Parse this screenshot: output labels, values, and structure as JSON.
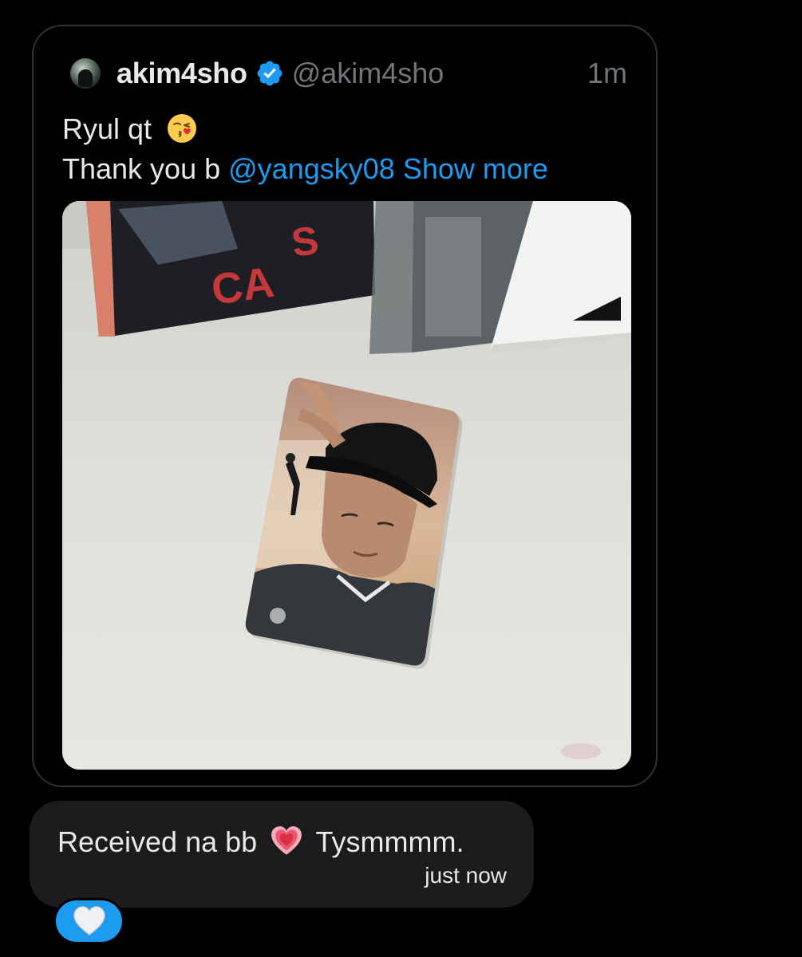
{
  "quoted_tweet": {
    "display_name": "akim4sho",
    "handle": "@akim4sho",
    "timestamp": "1m",
    "verified": true,
    "text_line1": "Ryul qt",
    "text_line2_prefix": "Thank you b",
    "mention": "@yangsky08",
    "show_more": "Show more",
    "emoji_line1": "kissing-heart-emoji",
    "media_description_icon": "photo",
    "link_color": "#1d9bf0"
  },
  "message": {
    "text_before_emoji": "Received na bb",
    "emoji": "growing-heart-emoji",
    "text_after_emoji": "Tysmmmm.",
    "time": "just now"
  },
  "reaction": {
    "emoji": "white-heart-emoji",
    "background": "#1d9bf0"
  }
}
